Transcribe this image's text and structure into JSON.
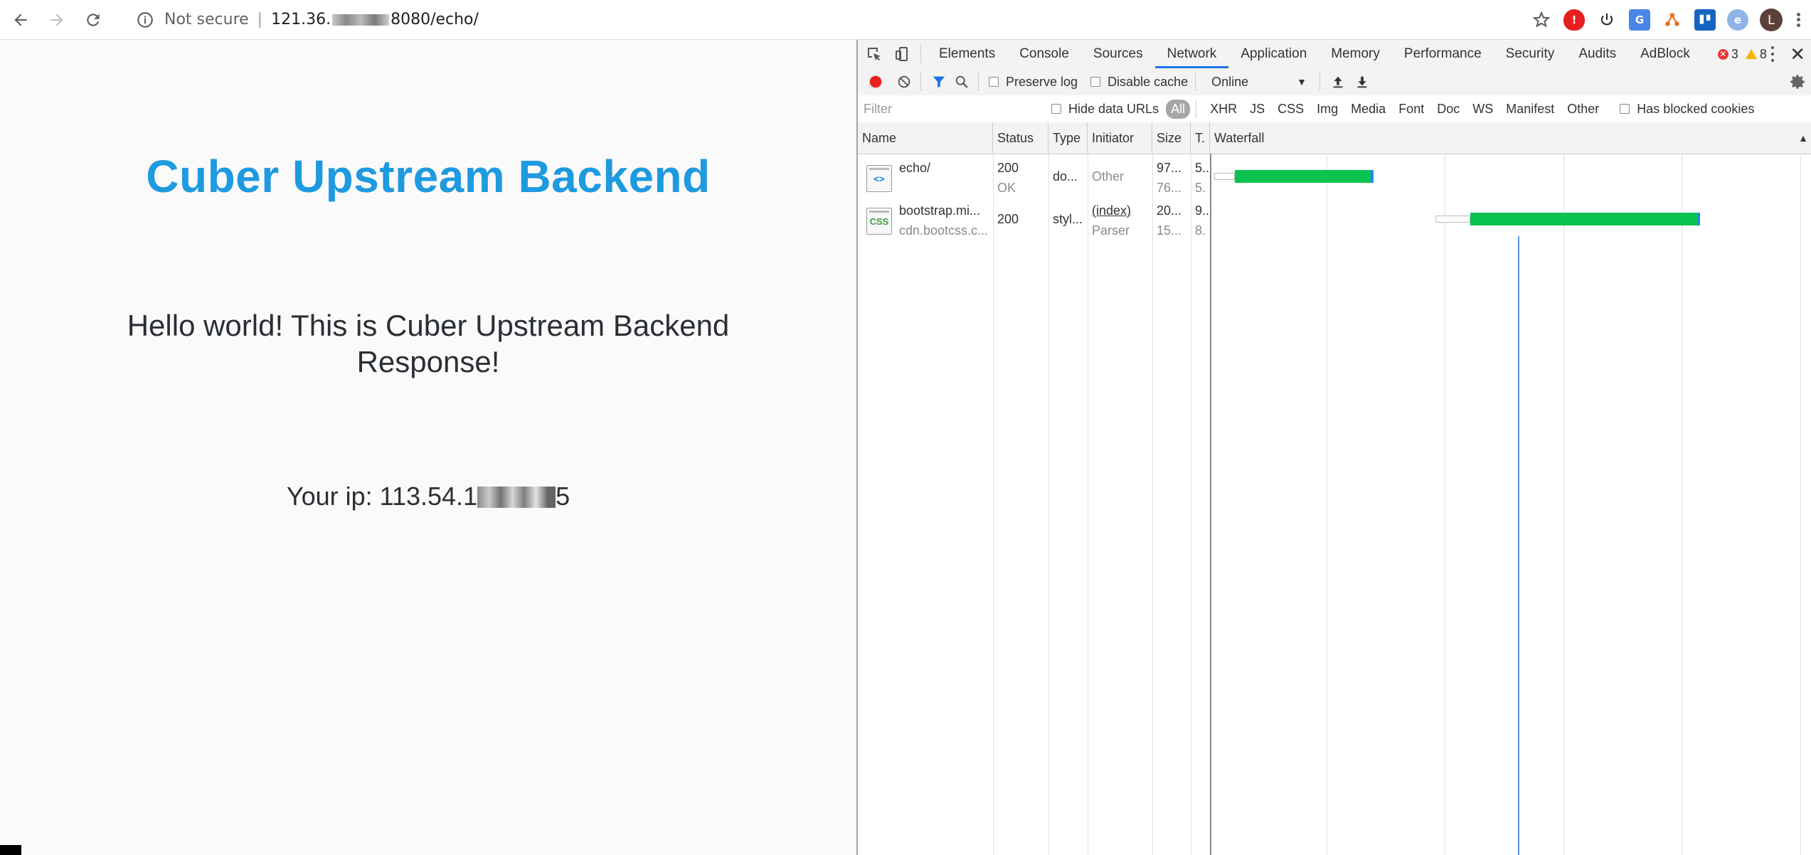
{
  "browser": {
    "security_label": "Not secure",
    "url_prefix": "121.36.",
    "url_suffix": "8080/echo/",
    "avatar_letter": "L"
  },
  "page": {
    "title": "Cuber Upstream Backend",
    "message": "Hello world! This is Cuber Upstream Backend Response!",
    "ip_prefix": "Your ip: 113.54.1",
    "ip_suffix": "5"
  },
  "devtools": {
    "tabs": [
      "Elements",
      "Console",
      "Sources",
      "Network",
      "Application",
      "Memory",
      "Performance",
      "Security",
      "Audits",
      "AdBlock"
    ],
    "active_tab": "Network",
    "error_count": "3",
    "warning_count": "8",
    "toolbar": {
      "preserve_log": "Preserve log",
      "disable_cache": "Disable cache",
      "throttle": "Online"
    },
    "filter": {
      "placeholder": "Filter",
      "hide_data_urls": "Hide data URLs",
      "types": [
        "All",
        "XHR",
        "JS",
        "CSS",
        "Img",
        "Media",
        "Font",
        "Doc",
        "WS",
        "Manifest",
        "Other"
      ],
      "active_type": "All",
      "blocked_cookies": "Has blocked cookies"
    },
    "columns": [
      "Name",
      "Status",
      "Type",
      "Initiator",
      "Size",
      "T.",
      "Waterfall"
    ],
    "requests": [
      {
        "name": "echo/",
        "subname": "",
        "status": "200",
        "status_text": "OK",
        "type": "do...",
        "initiator": "Other",
        "initiator_sub": "",
        "size": "97...",
        "size_sub": "76...",
        "time": "5...",
        "time_sub": "5.",
        "icon": "document-icon",
        "waterfall": {
          "wait_start": 0.005,
          "wait_end": 0.04,
          "start": 0.04,
          "end": 0.275
        }
      },
      {
        "name": "bootstrap.mi...",
        "subname": "cdn.bootcss.c...",
        "status": "200",
        "status_text": "",
        "type": "styl...",
        "initiator": "(index)",
        "initiator_sub": "Parser",
        "size": "20...",
        "size_sub": "15...",
        "time": "9...",
        "time_sub": "8.",
        "icon": "css-file-icon",
        "waterfall": {
          "wait_start": 0.38,
          "wait_end": 0.44,
          "start": 0.44,
          "end": 0.83
        }
      }
    ],
    "waterfall_marker": 0.52
  }
}
